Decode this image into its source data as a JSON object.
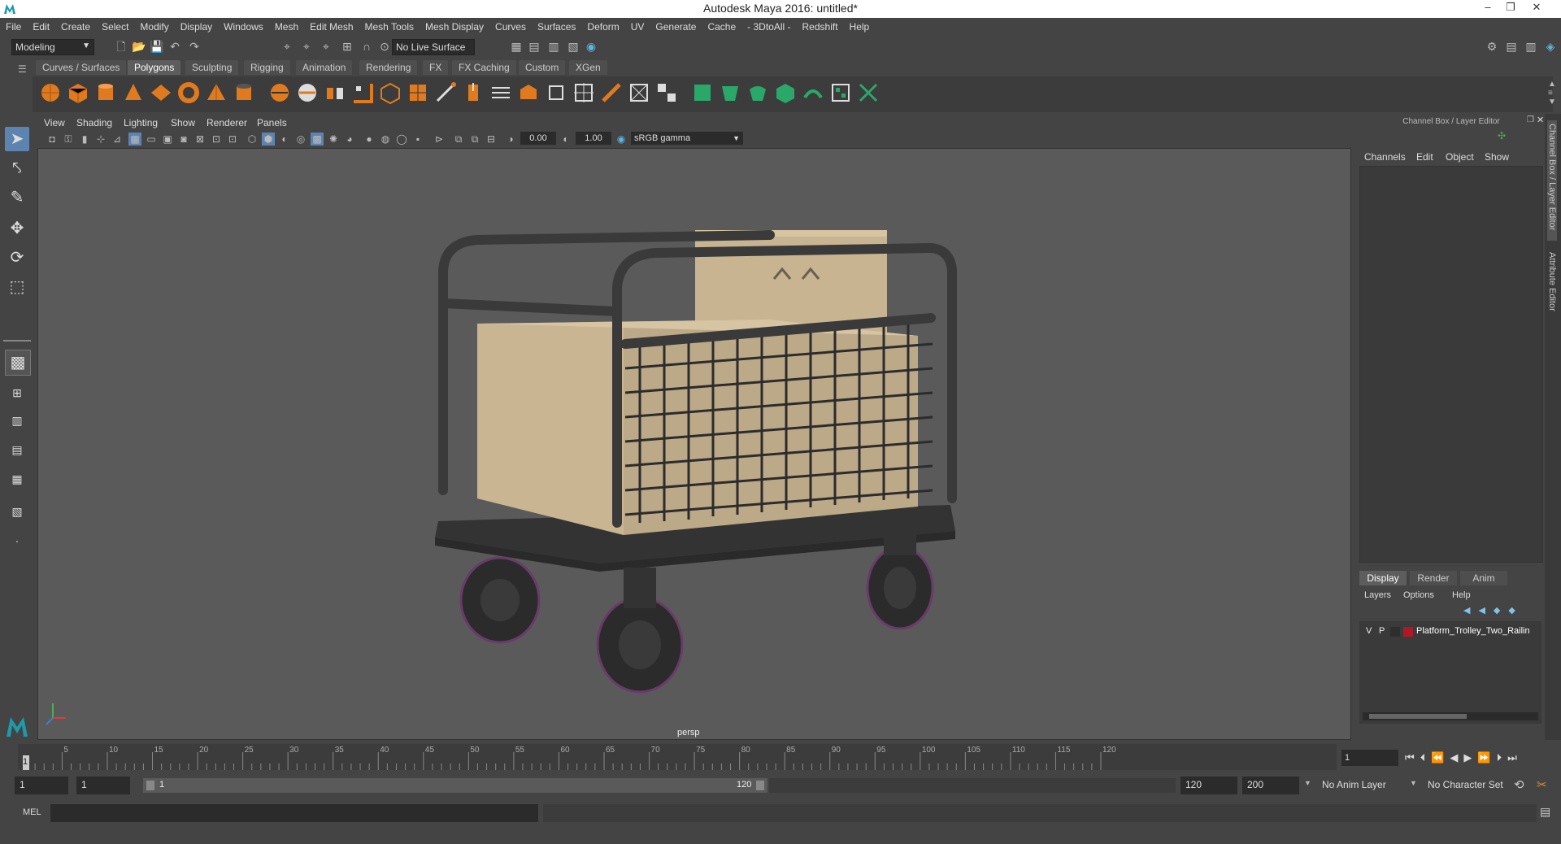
{
  "window": {
    "title": "Autodesk Maya 2016: untitled*"
  },
  "menubar": [
    "File",
    "Edit",
    "Create",
    "Select",
    "Modify",
    "Display",
    "Windows",
    "Mesh",
    "Edit Mesh",
    "Mesh Tools",
    "Mesh Display",
    "Curves",
    "Surfaces",
    "Deform",
    "UV",
    "Generate",
    "Cache",
    "- 3DtoAll -",
    "Redshift",
    "Help"
  ],
  "statusline": {
    "mode": "Modeling",
    "live_surface": "No Live Surface"
  },
  "shelf": {
    "tabs": [
      "Curves / Surfaces",
      "Polygons",
      "Sculpting",
      "Rigging",
      "Animation",
      "Rendering",
      "FX",
      "FX Caching",
      "Custom",
      "XGen"
    ],
    "active_tab": "Polygons"
  },
  "viewport": {
    "menus": [
      "View",
      "Shading",
      "Lighting",
      "Show",
      "Renderer",
      "Panels"
    ],
    "exposure": "0.00",
    "gamma": "1.00",
    "color_space": "sRGB gamma",
    "camera": "persp"
  },
  "channel_box": {
    "title": "Channel Box / Layer Editor",
    "menus": [
      "Channels",
      "Edit",
      "Object",
      "Show"
    ]
  },
  "layer_editor": {
    "tabs": [
      "Display",
      "Render",
      "Anim"
    ],
    "active_tab": "Display",
    "menus": [
      "Layers",
      "Options",
      "Help"
    ],
    "layers": [
      {
        "v": "V",
        "p": "P",
        "name": "Platform_Trolley_Two_Railin",
        "color": "#b01828"
      }
    ]
  },
  "side_tabs": [
    "Channel Box / Layer Editor",
    "Attribute Editor"
  ],
  "timeline": {
    "ticks": [
      "5",
      "10",
      "15",
      "20",
      "25",
      "30",
      "35",
      "40",
      "45",
      "50",
      "55",
      "60",
      "65",
      "70",
      "75",
      "80",
      "85",
      "90",
      "95",
      "100",
      "105",
      "110",
      "115",
      "120"
    ],
    "start_label": "1",
    "current_frame": "1"
  },
  "range": {
    "start": "1",
    "playback_start": "1",
    "slider_start": "1",
    "slider_end": "120",
    "playback_end": "120",
    "end": "200",
    "anim_layer": "No Anim Layer",
    "character_set": "No Character Set"
  },
  "commandline": {
    "label": "MEL"
  }
}
